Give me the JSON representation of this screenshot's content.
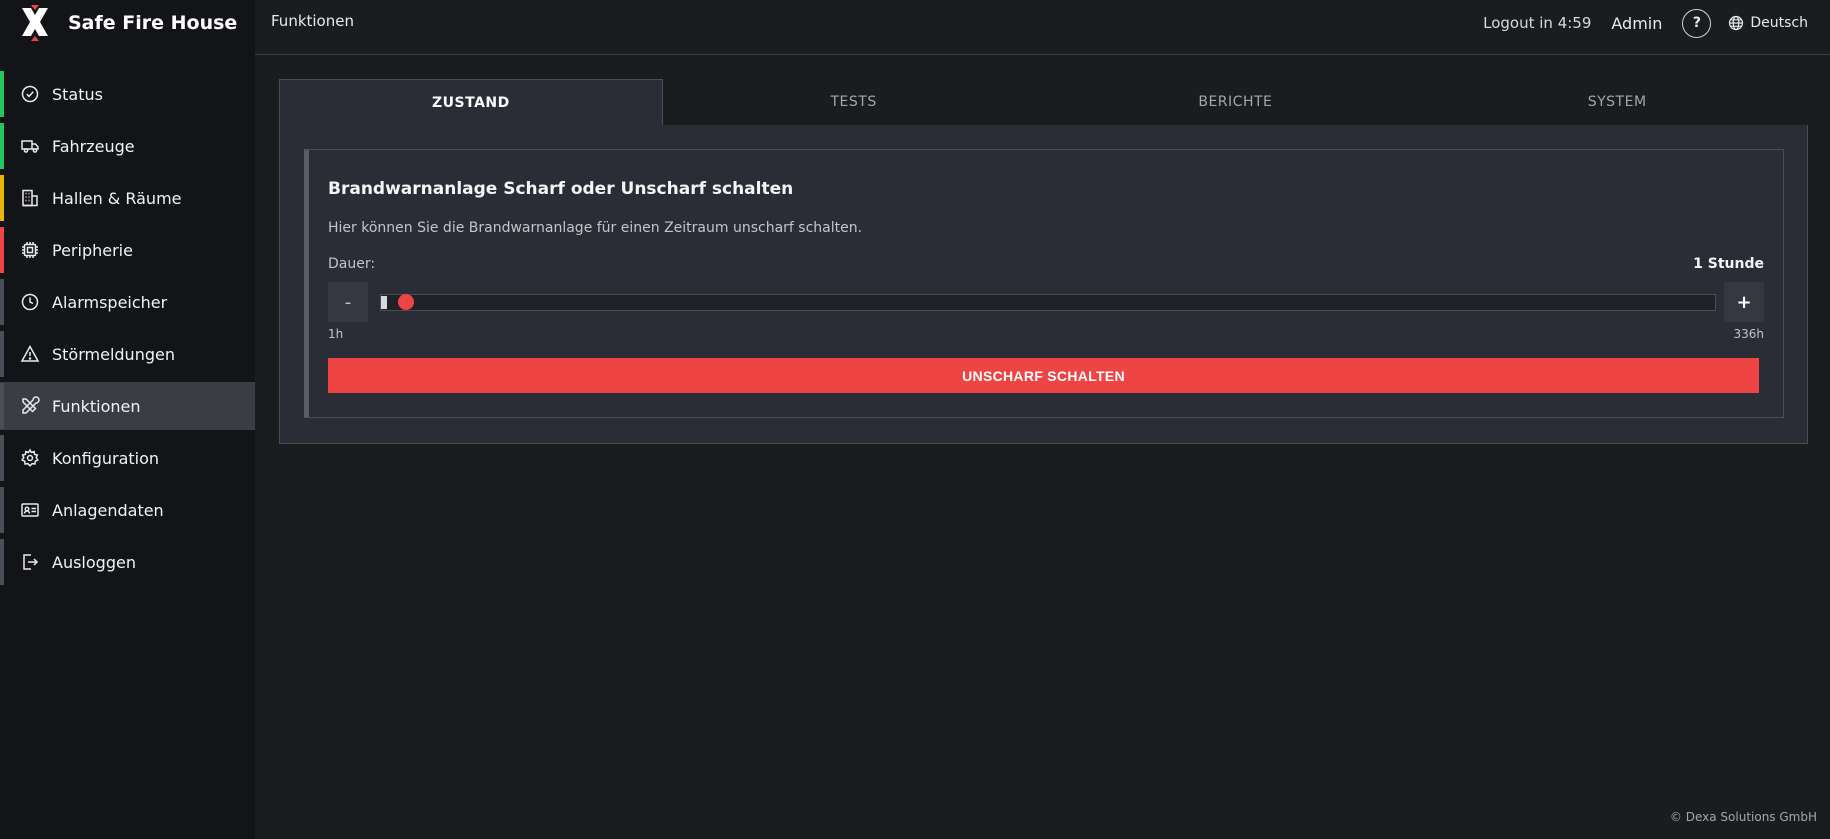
{
  "app": {
    "brand_name": "Safe Fire House",
    "page_title": "Funktionen"
  },
  "header": {
    "logout_timer": "Logout in 4:59",
    "user": "Admin",
    "help_label": "?",
    "language": "Deutsch"
  },
  "sidebar": {
    "items": [
      {
        "label": "Status",
        "icon": "check-circle-icon",
        "color": "#22c55e"
      },
      {
        "label": "Fahrzeuge",
        "icon": "truck-icon",
        "color": "#22c55e"
      },
      {
        "label": "Hallen & Räume",
        "icon": "building-icon",
        "color": "#eab308"
      },
      {
        "label": "Peripherie",
        "icon": "chip-icon",
        "color": "#ef4444"
      },
      {
        "label": "Alarmspeicher",
        "icon": "clock-icon",
        "color": "#4b4e56"
      },
      {
        "label": "Störmeldungen",
        "icon": "warning-icon",
        "color": "#4b4e56"
      },
      {
        "label": "Funktionen",
        "icon": "tools-icon",
        "color": "#4b4e56",
        "active": true
      },
      {
        "label": "Konfiguration",
        "icon": "gear-icon",
        "color": "#4b4e56"
      },
      {
        "label": "Anlagendaten",
        "icon": "id-card-icon",
        "color": "#4b4e56"
      },
      {
        "label": "Ausloggen",
        "icon": "logout-icon",
        "color": "#4b4e56"
      }
    ]
  },
  "tabs": [
    {
      "label": "ZUSTAND",
      "active": true
    },
    {
      "label": "TESTS",
      "active": false
    },
    {
      "label": "BERICHTE",
      "active": false
    },
    {
      "label": "SYSTEM",
      "active": false
    }
  ],
  "card": {
    "title": "Brandwarnanlage Scharf oder Unscharf schalten",
    "description": "Hier können Sie die Brandwarnanlage für einen Zeitraum unscharf schalten.",
    "duration_label": "Dauer:",
    "duration_value": "1 Stunde",
    "minus_label": "-",
    "plus_label": "+",
    "slider": {
      "min": 1,
      "max": 336,
      "value": 1
    },
    "range_min_label": "1h",
    "range_max_label": "336h",
    "action_label": "UNSCHARF SCHALTEN"
  },
  "colors": {
    "accent": "#ef4444",
    "active_nav_bg": "#3a3d43"
  },
  "footer": {
    "copyright": "© Dexa Solutions GmbH"
  }
}
